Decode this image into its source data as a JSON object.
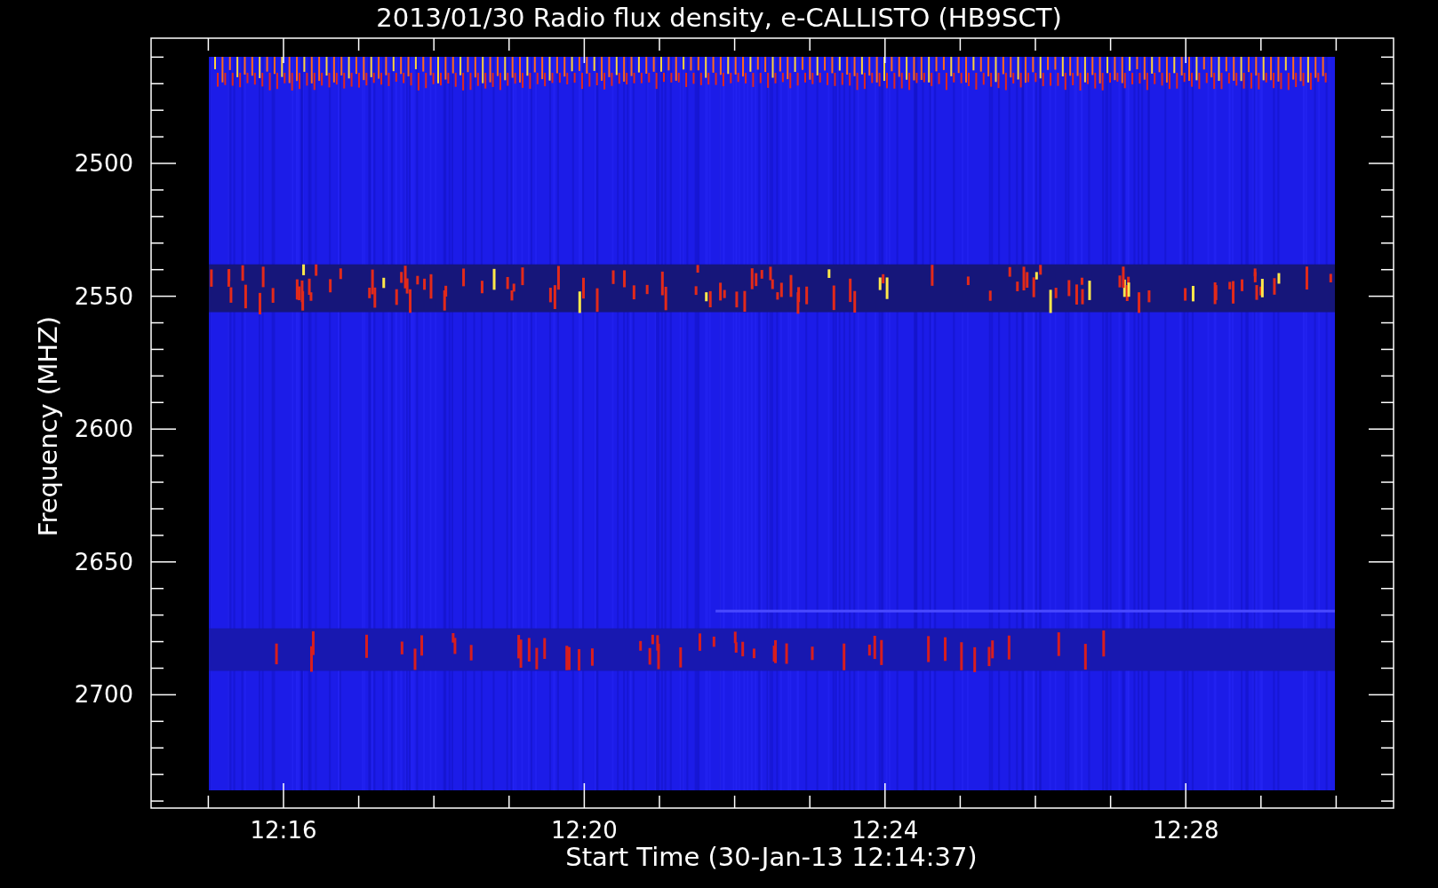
{
  "title": "2013/01/30  Radio flux density, e-CALLISTO (HB9SCT)",
  "y_axis": {
    "label": "Frequency (MHZ)",
    "ticks": [
      "2500",
      "2550",
      "2600",
      "2650",
      "2700"
    ]
  },
  "x_axis": {
    "label": "Start Time (30-Jan-13 12:14:37)",
    "ticks": [
      "12:16",
      "12:20",
      "12:24",
      "12:28"
    ]
  }
}
